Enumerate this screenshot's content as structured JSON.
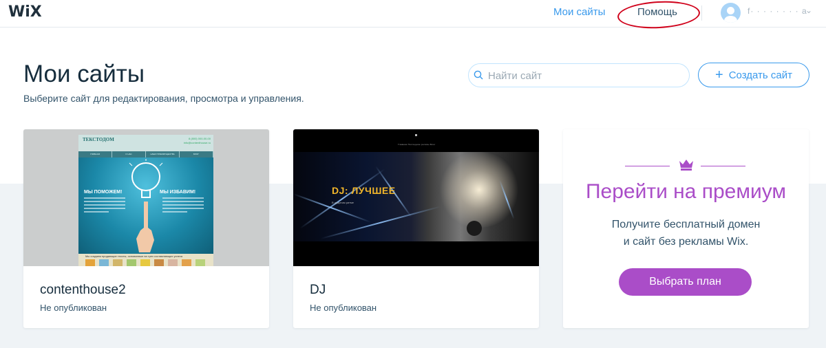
{
  "app": {
    "logo": "WiX"
  },
  "topbar": {
    "my_sites_label": "Мои сайты",
    "help_label": "Помощь",
    "user_name": "f·  ·  ·  ·  ·  ·  ·  ·  a",
    "highlight_color": "#d0021b"
  },
  "header": {
    "title": "Мои сайты",
    "subtitle": "Выберите сайт для редактирования, просмотра и управления."
  },
  "search": {
    "placeholder": "Найти сайт",
    "value": ""
  },
  "create_button": {
    "icon": "plus-icon",
    "label": "Создать сайт"
  },
  "sites": [
    {
      "name": "contenthouse2",
      "status": "Не опубликован",
      "thumbnail": {
        "logo": "ТЕКСТОДОМ",
        "contact_line1": "8 (800) 000-00-00",
        "contact_line2": "info@contenthouse.ru",
        "menu": [
          "ГЛАВНАЯ",
          "О НАС",
          "НАШИ ПРЕИМУЩЕСТВА",
          "БЛОГ"
        ],
        "headline_left": "МЫ ПОМОЖЕМ!",
        "headline_right": "МЫ ИЗБАВИМ!",
        "footer_text": "Мы создаем продающие тексты, основанные на трех составляющих успеха"
      }
    },
    {
      "name": "DJ",
      "status": "Не опубликован",
      "thumbnail": {
        "title": "DJ: ЛУЧШЕЕ",
        "subtitle": "В ударном ритме",
        "nav": "Главная    Последние релизы    Блог"
      }
    }
  ],
  "premium": {
    "icon": "crown-icon",
    "title": "Перейти на премиум",
    "text_line1": "Получите бесплатный домен",
    "text_line2": "и сайт без рекламы Wix.",
    "button_label": "Выбрать план",
    "accent_color": "#aa4dc8"
  },
  "colors": {
    "link_blue": "#3899ec",
    "band_grey": "#eff3f6",
    "text_dark": "#162d3d"
  }
}
